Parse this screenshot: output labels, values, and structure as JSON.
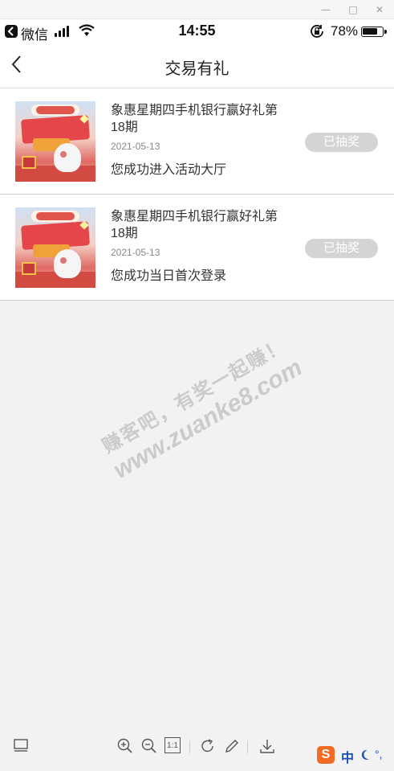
{
  "window": {
    "minimize": "—",
    "maximize": "□",
    "close": "✕"
  },
  "status_bar": {
    "back_app": "微信",
    "time": "14:55",
    "battery": "78%",
    "battery_level": 0.78,
    "icons": [
      "signal-icon",
      "wifi-icon",
      "orientation-lock-icon",
      "battery-icon"
    ]
  },
  "nav": {
    "title": "交易有礼",
    "back_icon": "chevron-left-icon"
  },
  "items": [
    {
      "title": "象惠星期四手机银行赢好礼第18期",
      "date": "2021-05-13",
      "description": "您成功进入活动大厅",
      "status": "已抽奖"
    },
    {
      "title": "象惠星期四手机银行赢好礼第18期",
      "date": "2021-05-13",
      "description": "您成功当日首次登录",
      "status": "已抽奖"
    }
  ],
  "watermark": {
    "line1": "赚客吧，有奖一起赚！",
    "line2": "www.zuanke8.com"
  },
  "toolbar": {
    "icons": [
      "layout-icon",
      "zoom-in-icon",
      "zoom-out-icon",
      "actual-size-icon",
      "rotate-icon",
      "edit-icon",
      "download-icon"
    ],
    "actual_size_label": "1:1"
  },
  "ime": {
    "logo": "S",
    "mode": "中",
    "dots": "°,"
  }
}
